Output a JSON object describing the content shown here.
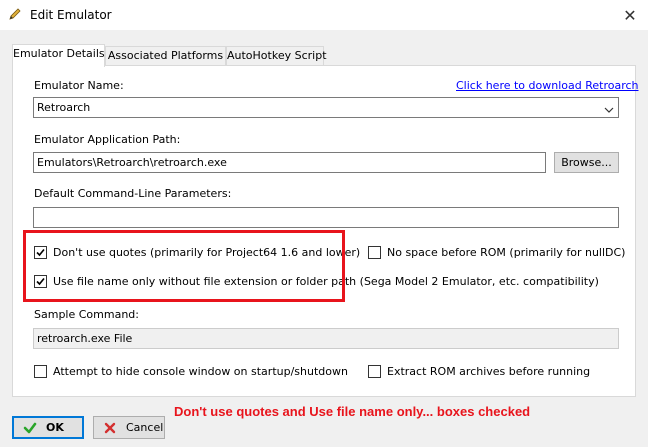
{
  "window": {
    "title": "Edit Emulator",
    "icon": "pencil-icon",
    "close_glyph": "✕"
  },
  "tabs": [
    {
      "label": "Emulator Details",
      "active": true
    },
    {
      "label": "Associated Platforms",
      "active": false
    },
    {
      "label": "AutoHotkey Script",
      "active": false
    }
  ],
  "details": {
    "emulator_name_label": "Emulator Name:",
    "download_link": "Click here to download Retroarch",
    "emulator_name_value": "Retroarch",
    "app_path_label": "Emulator Application Path:",
    "app_path_value": "Emulators\\Retroarch\\retroarch.exe",
    "browse_label": "Browse...",
    "params_label": "Default Command-Line Parameters:",
    "params_value": "",
    "dont_use_quotes_label": "Don't use quotes (primarily for Project64 1.6 and lower)",
    "dont_use_quotes_checked": true,
    "no_space_label": "No space before ROM (primarily for nullDC)",
    "no_space_checked": false,
    "file_name_only_label": "Use file name only without file extension or folder path (Sega Model 2 Emulator, etc. compatibility)",
    "file_name_only_checked": true,
    "sample_command_label": "Sample Command:",
    "sample_command_value": "retroarch.exe File",
    "hide_console_label": "Attempt to hide console window on startup/shutdown",
    "hide_console_checked": false,
    "extract_rom_label": "Extract ROM archives before running",
    "extract_rom_checked": false
  },
  "annotation": {
    "text": "Don't use quotes and Use file name only... boxes checked",
    "color": "#e8141c"
  },
  "buttons": {
    "ok_label": "OK",
    "cancel_label": "Cancel"
  },
  "colors": {
    "link": "#0000ff",
    "ok_icon": "#2aa52a",
    "cancel_icon": "#d32f2f",
    "focus_border": "#0078d7"
  }
}
